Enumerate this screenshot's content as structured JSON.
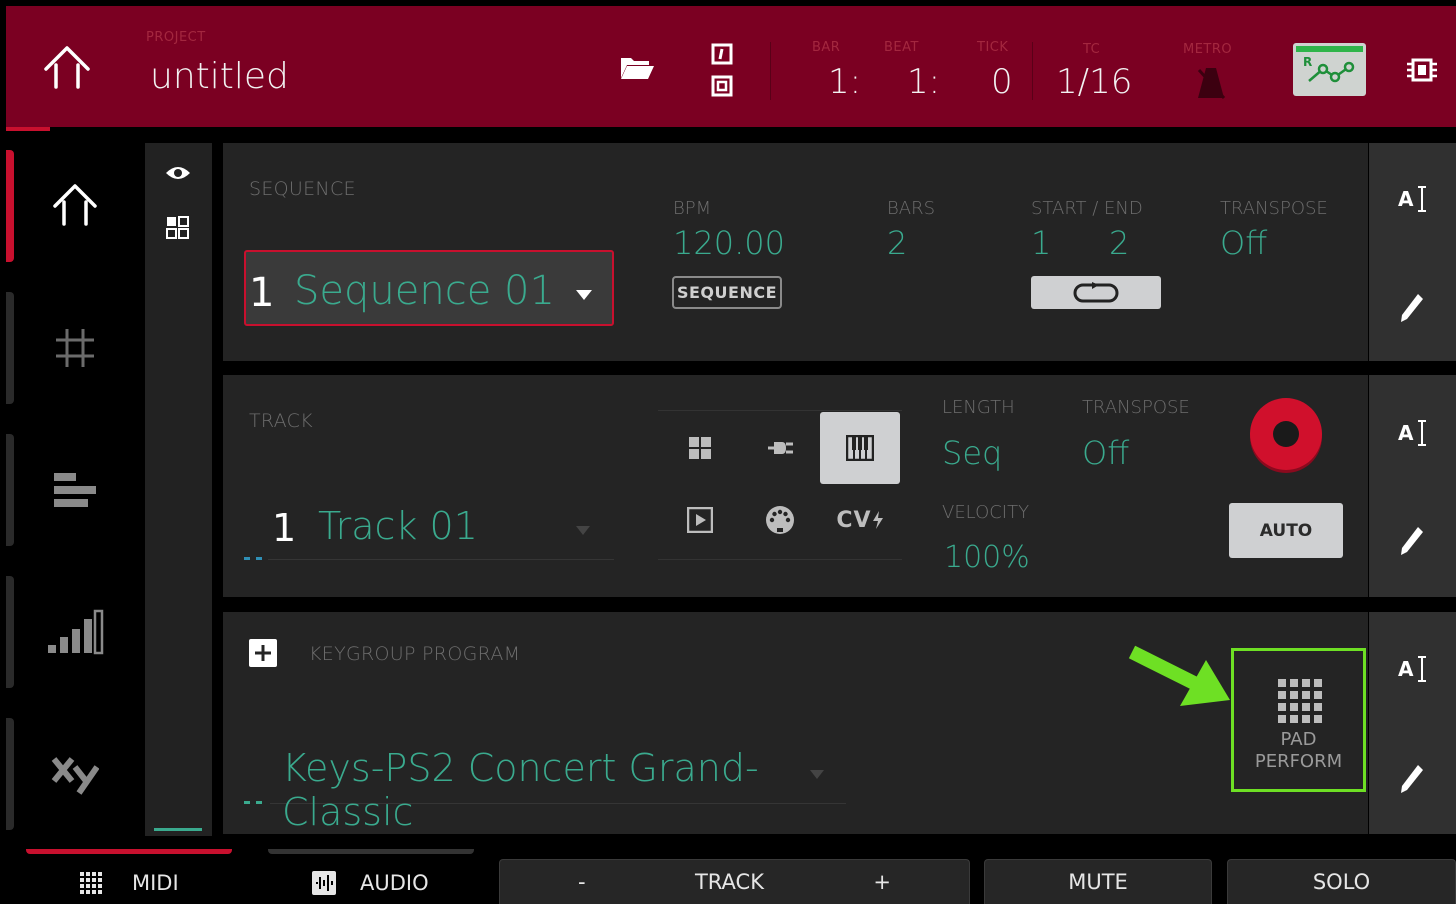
{
  "header": {
    "project_label": "PROJECT",
    "project_name": "untitled",
    "bar_label": "BAR",
    "bar_value": "1:",
    "beat_label": "BEAT",
    "beat_value": "1:",
    "tick_label": "TICK",
    "tick_value": "0",
    "tc_label": "TC",
    "tc_value": "1/16",
    "metro_label": "METRO",
    "automation_letter": "R",
    "icons": [
      "home-icon",
      "folder-icon",
      "record-mode-icon",
      "metronome-icon",
      "automation-icon",
      "cpu-icon"
    ]
  },
  "sidebar": {
    "items": [
      "home-icon",
      "grid-icon",
      "bars-icon",
      "mixer-levels-icon",
      "xy-icon"
    ]
  },
  "view_column": {
    "icons": [
      "eye-icon",
      "browser-grid-icon"
    ]
  },
  "sequence": {
    "label": "SEQUENCE",
    "number": "1",
    "name": "Sequence 01",
    "bpm_label": "BPM",
    "bpm_value": "120.00",
    "bpm_mode_button": "SEQUENCE",
    "bars_label": "BARS",
    "bars_value": "2",
    "start_end_label": "START / END",
    "start_value": "1",
    "end_value": "2",
    "transpose_label": "TRANSPOSE",
    "transpose_value": "Off"
  },
  "track": {
    "label": "TRACK",
    "number": "1",
    "name": "Track 01",
    "length_label": "LENGTH",
    "length_value": "Seq",
    "transpose_label": "TRANSPOSE",
    "transpose_value": "Off",
    "velocity_label": "VELOCITY",
    "velocity_value": "100%",
    "cv_label": "CV",
    "auto_button": "AUTO",
    "track_types": [
      "drum-icon",
      "plugin-icon",
      "keygroup-icon",
      "clip-icon",
      "midi-icon",
      "cv-icon"
    ],
    "selected_type": "keygroup-icon"
  },
  "program": {
    "label": "KEYGROUP PROGRAM",
    "name": "Keys-PS2 Concert Grand-Classic",
    "pad_perform_label_1": "PAD",
    "pad_perform_label_2": "PERFORM"
  },
  "bottom_bar": {
    "midi_label": "MIDI",
    "audio_label": "AUDIO",
    "track_minus": "-",
    "track_label": "TRACK",
    "track_plus": "+",
    "mute_label": "MUTE",
    "solo_label": "SOLO"
  },
  "colors": {
    "header": "#7b0022",
    "accent_red": "#c8102e",
    "teal": "#3aaa8e",
    "highlight_green": "#6ee024"
  }
}
